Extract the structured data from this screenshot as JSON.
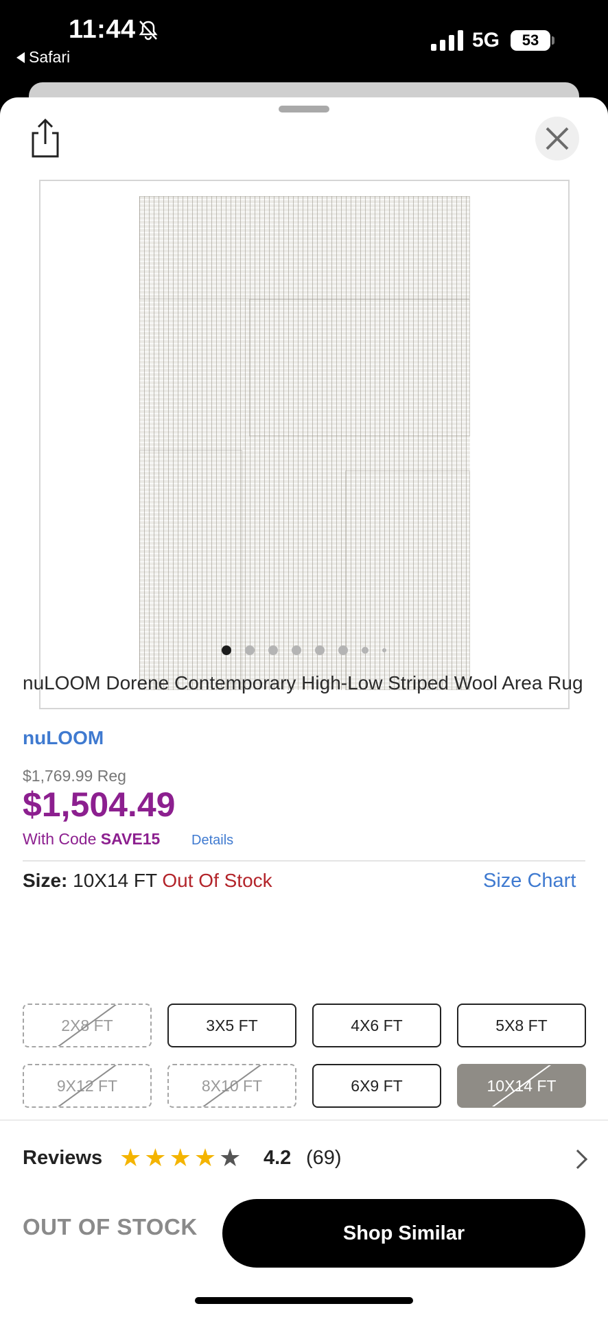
{
  "status_bar": {
    "time": "11:44",
    "back_app": "Safari",
    "network": "5G",
    "battery": "53"
  },
  "product": {
    "image_dots_count": 8,
    "title": "nuLOOM Dorene Contemporary High-Low Striped Wool Area Rug",
    "brand": "nuLOOM",
    "regular_price": "$1,769.99 Reg",
    "sale_price": "$1,504.49",
    "code_prefix": "With Code ",
    "code": "SAVE15",
    "details_label": "Details"
  },
  "size": {
    "label": "Size:",
    "selected": " 10X14 FT ",
    "availability": "Out Of Stock",
    "chart_label": "Size Chart",
    "options": [
      {
        "label": "2X8 FT",
        "state": "unavailable"
      },
      {
        "label": "3X5 FT",
        "state": "available"
      },
      {
        "label": "4X6 FT",
        "state": "available"
      },
      {
        "label": "5X8 FT",
        "state": "available"
      },
      {
        "label": "9X12 FT",
        "state": "unavailable"
      },
      {
        "label": "8X10 FT",
        "state": "unavailable"
      },
      {
        "label": "6X9 FT",
        "state": "available"
      },
      {
        "label": "10X14 FT",
        "state": "selected-unavailable"
      }
    ]
  },
  "reviews": {
    "label": "Reviews",
    "rating": "4.2",
    "count": "(69)",
    "stars_filled": 4
  },
  "footer": {
    "status": "OUT OF STOCK",
    "cta": "Shop Similar"
  },
  "colors": {
    "sale_purple": "#8c1f8f",
    "link_blue": "#3f7ad0",
    "out_of_stock_red": "#b3242a",
    "star_gold": "#f4b400"
  }
}
